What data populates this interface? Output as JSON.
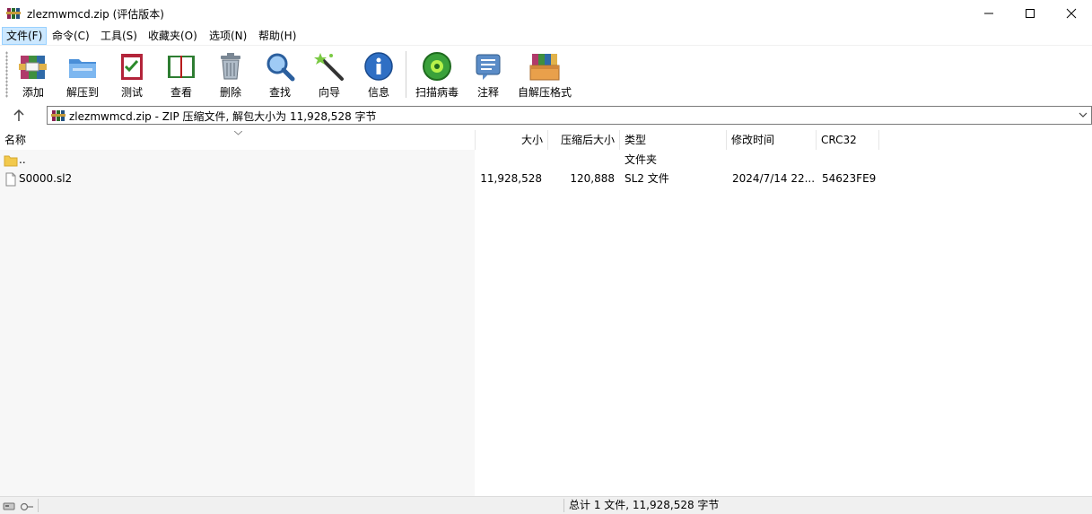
{
  "window": {
    "title": "zlezmwmcd.zip (评估版本)"
  },
  "menu": [
    "文件(F)",
    "命令(C)",
    "工具(S)",
    "收藏夹(O)",
    "选项(N)",
    "帮助(H)"
  ],
  "toolbar": {
    "add": "添加",
    "extract_to": "解压到",
    "test": "测试",
    "view": "查看",
    "delete": "删除",
    "find": "查找",
    "wizard": "向导",
    "info": "信息",
    "virus_scan": "扫描病毒",
    "comment": "注释",
    "sfx": "自解压格式"
  },
  "address": {
    "path": "zlezmwmcd.zip - ZIP 压缩文件, 解包大小为 11,928,528 字节"
  },
  "columns": {
    "name": "名称",
    "size": "大小",
    "packed": "压缩后大小",
    "type": "类型",
    "modified": "修改时间",
    "crc": "CRC32"
  },
  "rows": [
    {
      "name": "..",
      "size": "",
      "packed": "",
      "type": "文件夹",
      "modified": "",
      "crc": "",
      "icon": "folder-icon"
    },
    {
      "name": "S0000.sl2",
      "size": "11,928,528",
      "packed": "120,888",
      "type": "SL2 文件",
      "modified": "2024/7/14 22...",
      "crc": "54623FE9",
      "icon": "file-icon"
    }
  ],
  "status": {
    "summary": "总计 1 文件, 11,928,528 字节"
  },
  "colors": {
    "menu_active_bg": "#cce8ff",
    "list_bg": "#f7f7f7",
    "status_bg": "#f0f0f0"
  }
}
